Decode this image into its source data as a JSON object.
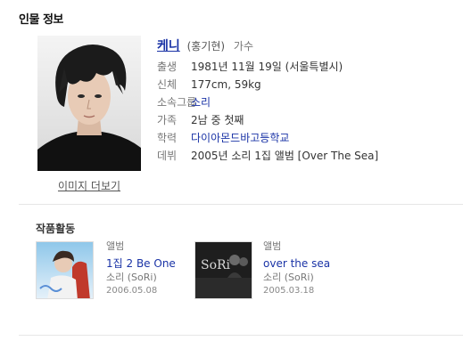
{
  "section_title": "인물 정보",
  "photo_link": "이미지 더보기",
  "person": {
    "name": "케니",
    "realname": "(홍기현)",
    "job": "가수"
  },
  "info": [
    {
      "label": "출생",
      "value": "1981년 11월 19일 (서울특별시)",
      "link": false
    },
    {
      "label": "신체",
      "value": "177cm, 59kg",
      "link": false
    },
    {
      "label": "소속그룹",
      "value": "소리",
      "link": true
    },
    {
      "label": "가족",
      "value": "2남 중 첫째",
      "link": false
    },
    {
      "label": "학력",
      "value": "다이아몬드바고등학교",
      "link": true
    },
    {
      "label": "데뷔",
      "value": "2005년 소리 1집 앨범 [Over The Sea]",
      "link": false
    }
  ],
  "works_title": "작품활동",
  "albums": [
    {
      "kind": "앨범",
      "title": "1집 2 Be One",
      "artist": "소리 (SoRi)",
      "date": "2006.05.08"
    },
    {
      "kind": "앨범",
      "title": "over the sea",
      "artist": "소리 (SoRi)",
      "date": "2005.03.18"
    }
  ],
  "cover_text": {
    "album2_logo": "SoRi"
  },
  "colors": {
    "link": "#1a33a6",
    "label": "#777777",
    "divider": "#e6e6e6"
  }
}
